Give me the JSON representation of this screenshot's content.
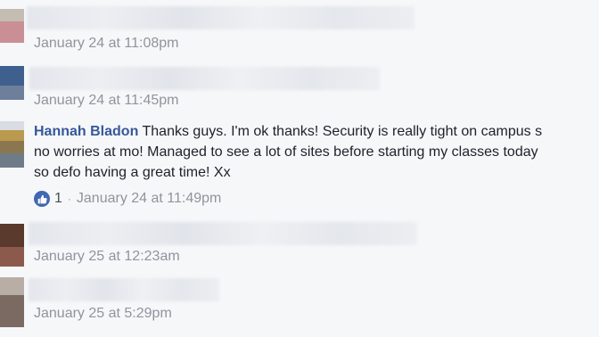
{
  "comments": [
    {
      "timestamp": "January 24 at 11:08pm"
    },
    {
      "timestamp": "January 24 at 11:45pm"
    },
    {
      "author": "Hannah Bladon",
      "lines": [
        "Thanks guys. I'm ok thanks! Security is really tight on campus s",
        "no worries at mo! Managed to see a lot of sites before starting my classes today",
        "so defo having a great time! Xx"
      ],
      "like_count": "1",
      "separator": "·",
      "timestamp": "January 24 at 11:49pm"
    },
    {
      "timestamp": "January 25 at 12:23am"
    },
    {
      "timestamp": "January 25 at 5:29pm"
    }
  ],
  "icons": {
    "reaction": "thumbs-up-icon"
  },
  "colors": {
    "author_link": "#365899",
    "timestamp": "#90949c",
    "like_badge": "#4267b2",
    "background": "#f6f7f9"
  }
}
